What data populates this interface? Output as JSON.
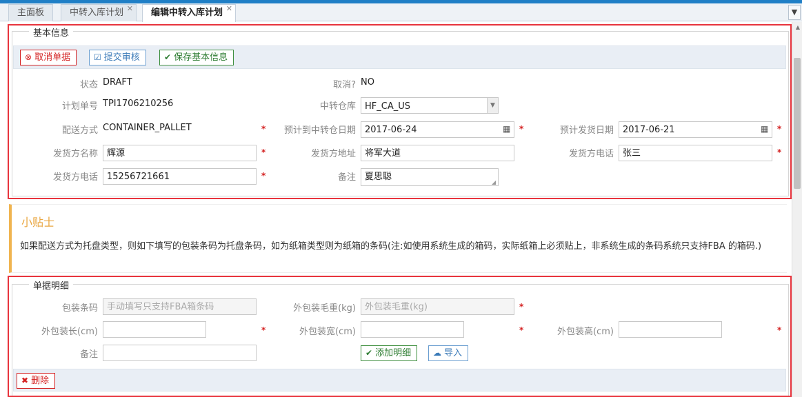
{
  "tabs": [
    {
      "label": "主面板",
      "active": false,
      "closable": false
    },
    {
      "label": "中转入库计划",
      "active": false,
      "closable": true
    },
    {
      "label": "编辑中转入库计划",
      "active": true,
      "closable": true
    }
  ],
  "tab_menu_icon": "chevron-down-icon",
  "basic_info": {
    "legend": "基本信息",
    "buttons": {
      "cancel_doc": "取消单据",
      "submit_review": "提交审核",
      "save_basic": "保存基本信息"
    },
    "fields": {
      "status_label": "状态",
      "status_value": "DRAFT",
      "cancelled_label": "取消?",
      "cancelled_value": "NO",
      "plan_no_label": "计划单号",
      "plan_no_value": "TPI1706210256",
      "warehouse_label": "中转仓库",
      "warehouse_value": "HF_CA_US",
      "delivery_method_label": "配送方式",
      "delivery_method_value": "CONTAINER_PALLET",
      "eta_label": "预计到中转仓日期",
      "eta_value": "2017-06-24",
      "ship_date_label": "预计发货日期",
      "ship_date_value": "2017-06-21",
      "shipper_name_label": "发货方名称",
      "shipper_name_value": "辉源",
      "shipper_address_label": "发货方地址",
      "shipper_address_value": "将军大道",
      "shipper_phone_label": "发货方电话",
      "shipper_phone_value": "张三",
      "shipper_phone2_label": "发货方电话",
      "shipper_phone2_value": "15256721661",
      "remark_label": "备注",
      "remark_value": "夏思聪"
    },
    "required_mark": "*"
  },
  "tips": {
    "title": "小贴士",
    "text": "如果配送方式为托盘类型，则如下填写的包装条码为托盘条码，如为纸箱类型则为纸箱的条码(注:如使用系统生成的箱码，实际纸箱上必须贴上，非系统生成的条码系统只支持FBA 的箱码.)"
  },
  "detail": {
    "legend": "单据明细",
    "barcode_label": "包装条码",
    "barcode_placeholder": "手动填写只支持FBA箱条码",
    "gross_weight_label": "外包装毛重(kg)",
    "gross_weight_placeholder": "外包装毛重(kg)",
    "length_label": "外包装长(cm)",
    "width_label": "外包装宽(cm)",
    "height_label": "外包装高(cm)",
    "remark_label": "备注",
    "add_button": "添加明细",
    "import_button": "导入",
    "delete_button": "删除"
  },
  "colors": {
    "highlight": "#e8343d",
    "accent": "#1f7fc6",
    "tips_border": "#f0b450"
  }
}
